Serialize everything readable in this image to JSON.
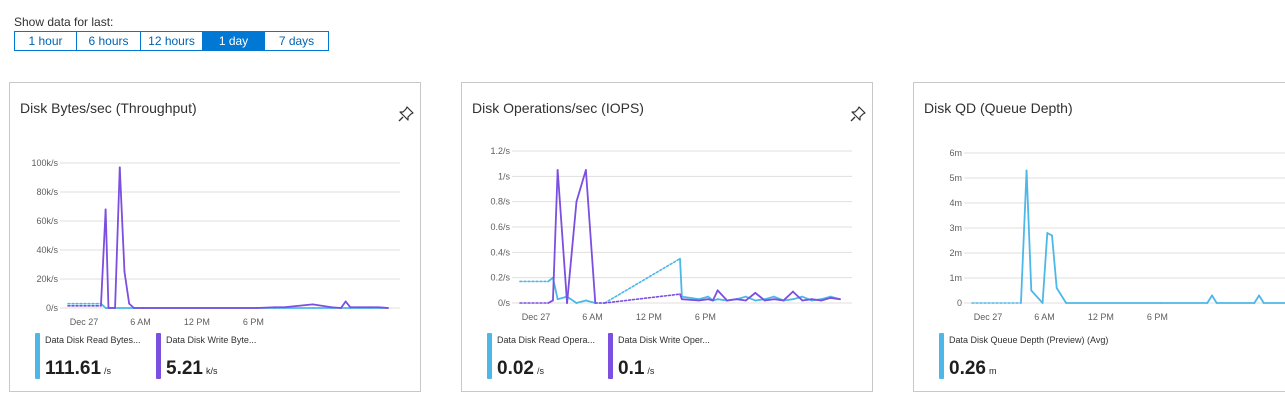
{
  "range": {
    "label": "Show data for last:",
    "options": [
      "1 hour",
      "6 hours",
      "12 hours",
      "1 day",
      "7 days"
    ],
    "selected": "1 day"
  },
  "colors": {
    "accent": "#0078d4",
    "read": "#4db8e8",
    "write": "#7b4fe0"
  },
  "icons": {
    "pin": "pin-icon"
  },
  "cards": [
    {
      "title": "Disk Bytes/sec (Throughput)",
      "legend": [
        {
          "name": "Data Disk Read Bytes...",
          "value": "111.61",
          "unit": "/s"
        },
        {
          "name": "Data Disk Write Byte...",
          "value": "5.21",
          "unit": "k/s"
        }
      ]
    },
    {
      "title": "Disk Operations/sec (IOPS)",
      "legend": [
        {
          "name": "Data Disk Read Opera...",
          "value": "0.02",
          "unit": "/s"
        },
        {
          "name": "Data Disk Write Oper...",
          "value": "0.1",
          "unit": "/s"
        }
      ]
    },
    {
      "title": "Disk QD (Queue Depth)",
      "legend": [
        {
          "name": "Data Disk Queue Depth (Preview) (Avg)",
          "value": "0.26",
          "unit": "m"
        }
      ]
    }
  ],
  "chart_data": [
    {
      "type": "line",
      "x_ticks": [
        "Dec 27",
        "6 AM",
        "12 PM",
        "6 PM"
      ],
      "y_ticks": [
        "0/s",
        "20k/s",
        "40k/s",
        "60k/s",
        "80k/s",
        "100k/s"
      ],
      "ylim": [
        0,
        100000
      ],
      "grid": true,
      "x_hours": [
        0,
        3,
        3.5,
        4,
        4.3,
        5,
        5.5,
        6,
        6.5,
        7,
        8,
        20,
        22,
        22.5,
        23,
        26,
        28,
        29,
        29.5,
        30,
        31,
        32,
        33,
        34
      ],
      "series": [
        {
          "values": [
            3000,
            3000,
            3000,
            0,
            0,
            0,
            0,
            0,
            0,
            0,
            0,
            0,
            0,
            0,
            0,
            0,
            0,
            0,
            0,
            0,
            0,
            0,
            0,
            0
          ],
          "dashed_until": 3.5,
          "color": "#4db8e8"
        },
        {
          "values": [
            1500,
            1500,
            1500,
            68000,
            0,
            0,
            97000,
            25000,
            3000,
            0,
            0,
            0,
            500,
            500,
            500,
            2500,
            500,
            0,
            4500,
            500,
            500,
            500,
            500,
            0
          ],
          "dashed_until": 3.5,
          "color": "#7b4fe0"
        }
      ]
    },
    {
      "type": "line",
      "x_ticks": [
        "Dec 27",
        "6 AM",
        "12 PM",
        "6 PM"
      ],
      "y_ticks": [
        "0/s",
        "0.2/s",
        "0.4/s",
        "0.6/s",
        "0.8/s",
        "1/s",
        "1.2/s"
      ],
      "ylim": [
        0,
        1.2
      ],
      "grid": true,
      "x_hours": [
        0,
        3,
        3.5,
        4,
        5,
        6,
        7,
        8,
        9,
        17,
        17.2,
        19,
        20,
        20.5,
        21,
        22,
        23,
        24,
        25,
        26,
        27,
        28,
        29,
        30,
        31,
        32,
        33,
        34
      ],
      "series": [
        {
          "values": [
            0.17,
            0.17,
            0.2,
            0.03,
            0.05,
            0.0,
            0.02,
            0.0,
            0.0,
            0.35,
            0.05,
            0.03,
            0.05,
            0.02,
            0.03,
            0.02,
            0.03,
            0.05,
            0.02,
            0.03,
            0.05,
            0.02,
            0.03,
            0.05,
            0.02,
            0.03,
            0.05,
            0.03
          ],
          "dashed_ranges": [
            [
              0,
              3
            ],
            [
              8,
              17
            ]
          ],
          "color": "#4db8e8"
        },
        {
          "values": [
            0.0,
            0.0,
            0.02,
            1.05,
            0.0,
            0.8,
            1.05,
            0.0,
            0.0,
            0.07,
            0.03,
            0.02,
            0.03,
            0.02,
            0.1,
            0.02,
            0.03,
            0.02,
            0.08,
            0.02,
            0.03,
            0.02,
            0.09,
            0.02,
            0.03,
            0.02,
            0.04,
            0.03
          ],
          "dashed_ranges": [
            [
              0,
              3
            ],
            [
              8,
              17
            ]
          ],
          "color": "#7b4fe0"
        }
      ]
    },
    {
      "type": "line",
      "x_ticks": [
        "Dec 27",
        "6 AM",
        "12 PM",
        "6 PM"
      ],
      "y_ticks": [
        "0",
        "1m",
        "2m",
        "3m",
        "4m",
        "5m",
        "6m"
      ],
      "ylim": [
        0,
        6
      ],
      "grid": true,
      "x_hours": [
        0,
        5.2,
        5.8,
        6.3,
        7.5,
        8,
        8.5,
        9,
        10,
        20,
        25,
        25.5,
        26,
        30,
        30.5,
        31,
        34
      ],
      "series": [
        {
          "values": [
            0,
            0,
            5.3,
            0.5,
            0,
            2.8,
            2.7,
            0.6,
            0,
            0,
            0,
            0.3,
            0,
            0,
            0.3,
            0,
            0
          ],
          "dashed_until": 5.2,
          "color": "#4db8e8"
        }
      ]
    }
  ]
}
